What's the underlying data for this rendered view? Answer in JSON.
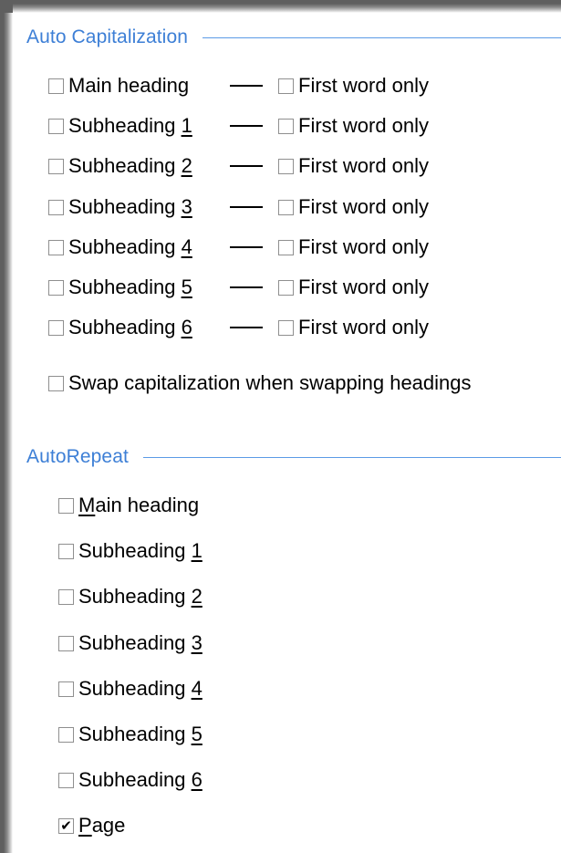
{
  "auto_capitalization": {
    "title": "Auto Capitalization",
    "rows": [
      {
        "pre": "Main heading",
        "acc": "",
        "post": "",
        "checked": false,
        "first_word_only": {
          "label": "First word only",
          "checked": false
        }
      },
      {
        "pre": "Subheading ",
        "acc": "1",
        "post": "",
        "checked": false,
        "first_word_only": {
          "label": "First word only",
          "checked": false
        }
      },
      {
        "pre": "Subheading ",
        "acc": "2",
        "post": "",
        "checked": false,
        "first_word_only": {
          "label": "First word only",
          "checked": false
        }
      },
      {
        "pre": "Subheading ",
        "acc": "3",
        "post": "",
        "checked": false,
        "first_word_only": {
          "label": "First word only",
          "checked": false
        }
      },
      {
        "pre": "Subheading ",
        "acc": "4",
        "post": "",
        "checked": false,
        "first_word_only": {
          "label": "First word only",
          "checked": false
        }
      },
      {
        "pre": "Subheading ",
        "acc": "5",
        "post": "",
        "checked": false,
        "first_word_only": {
          "label": "First word only",
          "checked": false
        }
      },
      {
        "pre": "Subheading ",
        "acc": "6",
        "post": "",
        "checked": false,
        "first_word_only": {
          "label": "First word only",
          "checked": false
        }
      }
    ],
    "swap": {
      "label": "Swap capitalization when swapping headings",
      "checked": false
    }
  },
  "auto_repeat": {
    "title": "AutoRepeat",
    "items": [
      {
        "pre": "",
        "acc": "M",
        "post": "ain heading",
        "checked": false
      },
      {
        "pre": "Subheading ",
        "acc": "1",
        "post": "",
        "checked": false
      },
      {
        "pre": "Subheading ",
        "acc": "2",
        "post": "",
        "checked": false
      },
      {
        "pre": "Subheading ",
        "acc": "3",
        "post": "",
        "checked": false
      },
      {
        "pre": "Subheading ",
        "acc": "4",
        "post": "",
        "checked": false
      },
      {
        "pre": "Subheading ",
        "acc": "5",
        "post": "",
        "checked": false
      },
      {
        "pre": "Subheading ",
        "acc": "6",
        "post": "",
        "checked": false
      },
      {
        "pre": "",
        "acc": "P",
        "post": "age",
        "checked": true
      }
    ]
  },
  "icons": {
    "checkbox_checked": "checkmark-icon"
  },
  "colors": {
    "group_title": "#3d7fd6",
    "group_line": "#5b9be6",
    "checkbox_border": "#8f8f8f"
  }
}
